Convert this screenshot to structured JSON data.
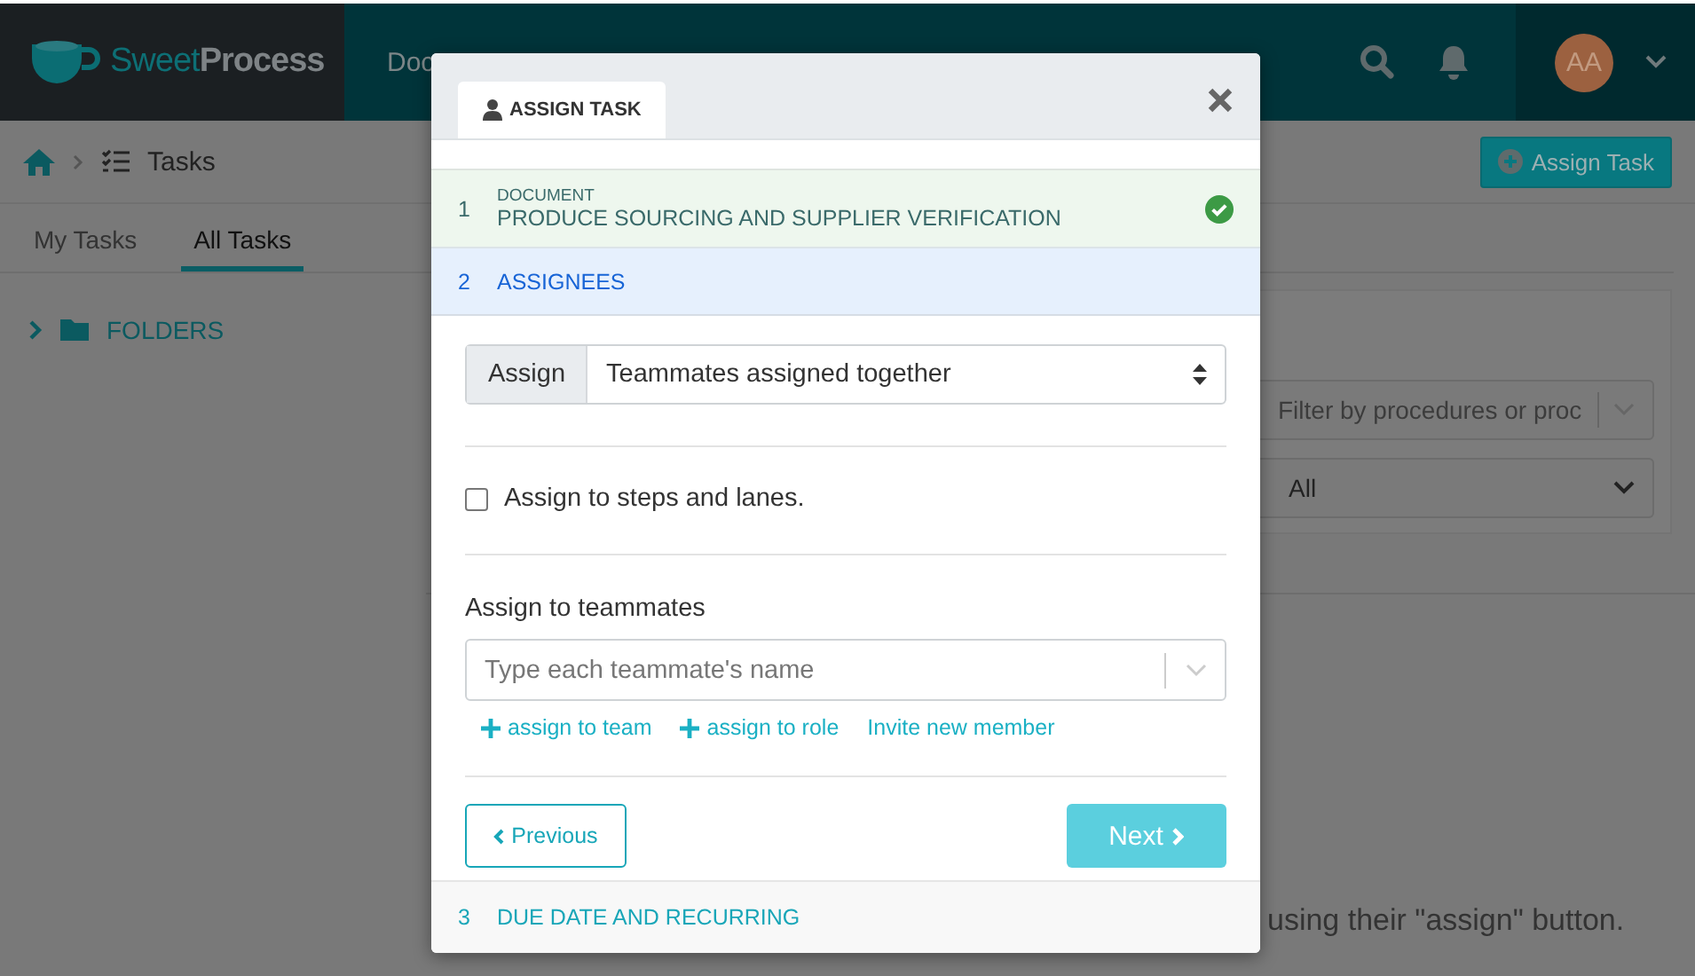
{
  "header": {
    "logo": "Sweet**Process**",
    "nav": [
      {
        "label": "Doc"
      }
    ],
    "avatar": "AA"
  },
  "breadcrumb": {
    "current": "Tasks"
  },
  "assign_button": "Assign Task",
  "tabs": [
    {
      "label": "My Tasks",
      "selected": false
    },
    {
      "label": "All Tasks",
      "selected": true
    }
  ],
  "sidebar": {
    "folders": {
      "label": "FOLDERS",
      "expanded": false
    }
  },
  "filters": {
    "search_placeholder": "Filter by procedures or proc",
    "status": "All"
  },
  "background_text": "using their \"assign\" button.",
  "modal": {
    "tab": "ASSIGN TASK",
    "steps": [
      {
        "number": "1",
        "caption": "DOCUMENT",
        "title": "PRODUCE SOURCING AND SUPPLIER VERIFICATION",
        "completed": true,
        "selected": false
      },
      {
        "number": "2",
        "title": "ASSIGNEES",
        "completed": false,
        "selected": true
      },
      {
        "number": "3",
        "title": "DUE DATE AND RECURRING",
        "completed": false,
        "selected": false
      }
    ],
    "assign_select": {
      "label": "Assign",
      "value": "Teammates assigned together"
    },
    "steps_checkbox": {
      "label": "Assign to steps and lanes.",
      "checked": false
    },
    "teammates": {
      "label": "Assign to teammates",
      "placeholder": "Type each teammate's name"
    },
    "links": [
      {
        "label": "assign to team",
        "kind": "add"
      },
      {
        "label": "assign to role",
        "kind": "add"
      },
      {
        "label": "Invite new member",
        "kind": "plain"
      }
    ],
    "previous": "Previous",
    "next": "Next"
  }
}
